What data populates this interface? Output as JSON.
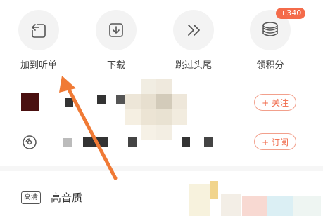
{
  "actions": [
    {
      "label": "加到听单",
      "icon": "add-to-playlist-icon"
    },
    {
      "label": "下载",
      "icon": "download-icon"
    },
    {
      "label": "跳过头尾",
      "icon": "skip-forward-icon"
    },
    {
      "label": "领积分",
      "icon": "coins-icon",
      "badge": "+340"
    }
  ],
  "rows": {
    "follow_label": "+ 关注",
    "subscribe_label": "+ 订阅"
  },
  "quality": {
    "tag": "高清",
    "label": "高音质"
  },
  "colors": {
    "accent": "#f06a4a",
    "arrow": "#f07a35"
  }
}
